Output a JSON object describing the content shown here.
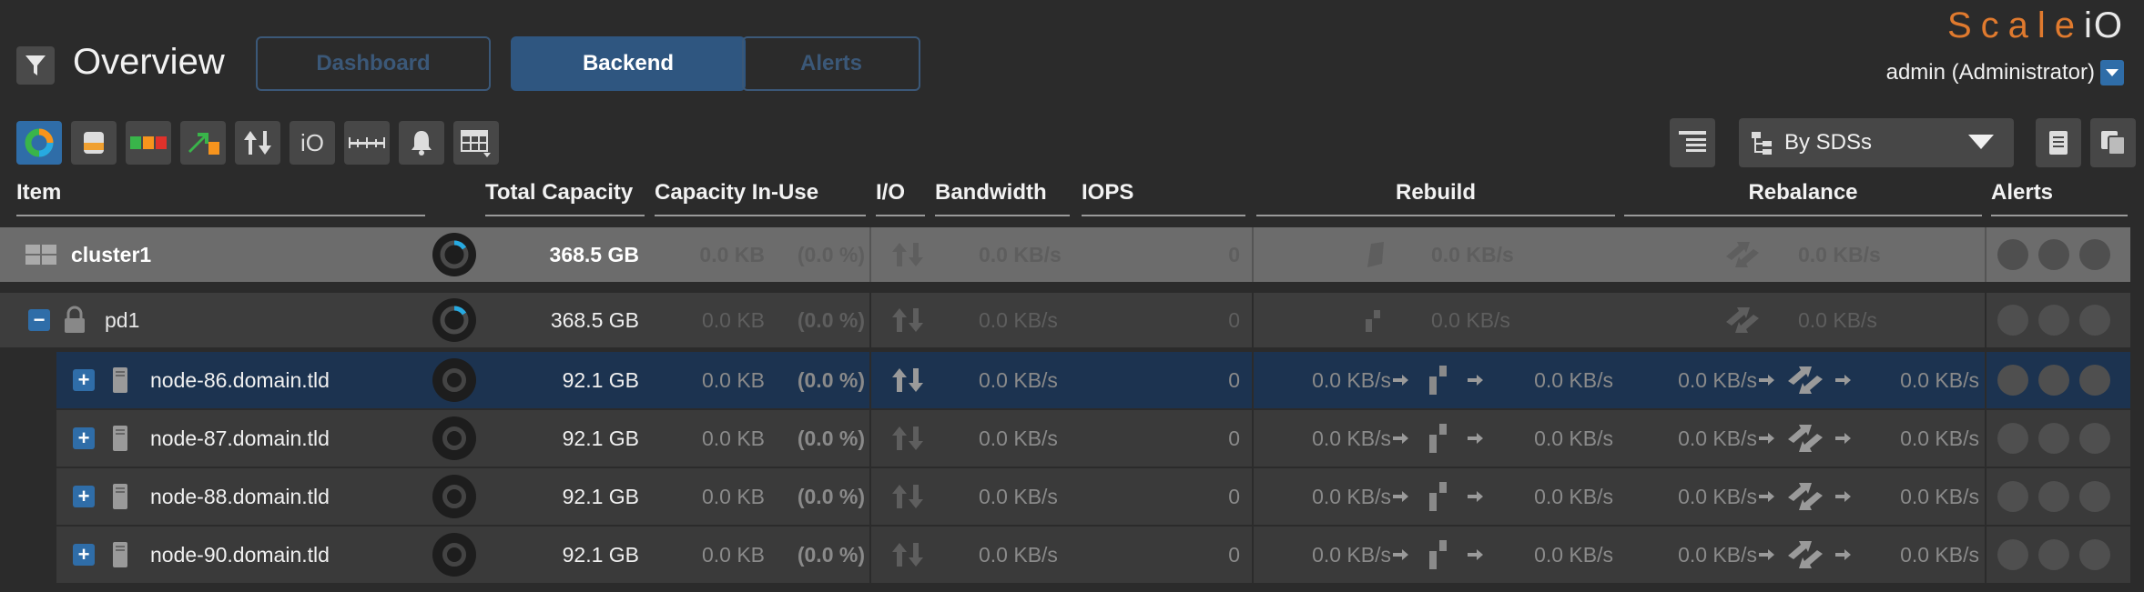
{
  "header": {
    "title": "Overview",
    "tabs": [
      {
        "label": "Dashboard",
        "active": false
      },
      {
        "label": "Backend",
        "active": true
      },
      {
        "label": "Alerts",
        "active": false
      }
    ],
    "logo_main": "Scale",
    "logo_suffix": "iO",
    "user": "admin (Administrator)"
  },
  "toolbar": {
    "view_select": "By SDSs",
    "io_label": "iO"
  },
  "columns": {
    "item": "Item",
    "total_capacity": "Total Capacity",
    "capacity_in_use": "Capacity In-Use",
    "io": "I/O",
    "bandwidth": "Bandwidth",
    "iops": "IOPS",
    "rebuild": "Rebuild",
    "rebalance": "Rebalance",
    "alerts": "Alerts"
  },
  "cluster": {
    "name": "cluster1",
    "total": "368.5 GB",
    "in_use": "0.0 KB",
    "in_use_pct": "(0.0 %)",
    "bandwidth": "0.0 KB/s",
    "iops": "0",
    "rebuild": "0.0 KB/s",
    "rebalance": "0.0 KB/s"
  },
  "pd": {
    "name": "pd1",
    "total": "368.5 GB",
    "in_use": "0.0 KB",
    "in_use_pct": "(0.0 %)",
    "bandwidth": "0.0 KB/s",
    "iops": "0",
    "rebuild": "0.0 KB/s",
    "rebalance": "0.0 KB/s"
  },
  "nodes": [
    {
      "name": "node-86.domain.tld",
      "total": "92.1 GB",
      "in_use": "0.0 KB",
      "in_use_pct": "(0.0 %)",
      "bandwidth": "0.0 KB/s",
      "iops": "0",
      "rebuild_in": "0.0 KB/s",
      "rebuild_out": "0.0 KB/s",
      "rebalance_in": "0.0 KB/s",
      "rebalance_out": "0.0 KB/s"
    },
    {
      "name": "node-87.domain.tld",
      "total": "92.1 GB",
      "in_use": "0.0 KB",
      "in_use_pct": "(0.0 %)",
      "bandwidth": "0.0 KB/s",
      "iops": "0",
      "rebuild_in": "0.0 KB/s",
      "rebuild_out": "0.0 KB/s",
      "rebalance_in": "0.0 KB/s",
      "rebalance_out": "0.0 KB/s"
    },
    {
      "name": "node-88.domain.tld",
      "total": "92.1 GB",
      "in_use": "0.0 KB",
      "in_use_pct": "(0.0 %)",
      "bandwidth": "0.0 KB/s",
      "iops": "0",
      "rebuild_in": "0.0 KB/s",
      "rebuild_out": "0.0 KB/s",
      "rebalance_in": "0.0 KB/s",
      "rebalance_out": "0.0 KB/s"
    },
    {
      "name": "node-90.domain.tld",
      "total": "92.1 GB",
      "in_use": "0.0 KB",
      "in_use_pct": "(0.0 %)",
      "bandwidth": "0.0 KB/s",
      "iops": "0",
      "rebuild_in": "0.0 KB/s",
      "rebuild_out": "0.0 KB/s",
      "rebalance_in": "0.0 KB/s",
      "rebalance_out": "0.0 KB/s"
    }
  ],
  "colors": {
    "accent": "#2f6da8",
    "tab_active": "#2f5680",
    "logo": "#e07a2e",
    "selected_row": "#1c3350"
  }
}
